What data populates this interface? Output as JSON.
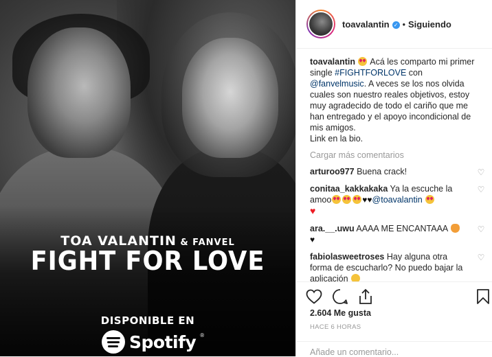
{
  "artwork": {
    "artist1": "TOA VALANTIN",
    "ampersand": "& FANVEL",
    "title": "FIGHT FOR LOVE",
    "available": "DISPONIBLE EN",
    "service": "Spotify"
  },
  "header": {
    "username": "toavalantin",
    "separator": "•",
    "follow_status": "Siguiendo"
  },
  "caption": {
    "username": "toavalantin",
    "text_before": " Acá les comparto mi primer single ",
    "hashtag": "#FIGHTFORLOVE",
    "text_mid": " con ",
    "mention": "@fanvelmusic",
    "text_after": ". A veces se los nos olvida cuales son nuestro reales objetivos, estoy muy agradecido de todo el cariño que me han entregado y el apoyo incondicional de mis amigos.",
    "link_line": "Link en la bio."
  },
  "load_more": "Cargar más comentarios",
  "comments": [
    {
      "user": "arturoo977",
      "text": " Buena crack!"
    },
    {
      "user": "conitaa_kakkakaka",
      "text_a": " Ya la escuche la amoo",
      "mention": "@toavalantin"
    },
    {
      "user": "ara.__.uwu",
      "text": " AAAA ME ENCANTAAA "
    },
    {
      "user": "fabiolasweetroses",
      "text": " Hay alguna otra forma de escucharlo? No puedo bajar la aplicación "
    }
  ],
  "likes": "2.604 Me gusta",
  "time": "HACE 6 HORAS",
  "add_comment_placeholder": "Añade un comentario...",
  "colors": {
    "link": "#003569",
    "verified": "#3897f0",
    "muted": "#999999",
    "text": "#262626"
  },
  "icons": [
    "heart-icon",
    "comment-icon",
    "share-icon",
    "bookmark-icon",
    "verified-icon"
  ]
}
